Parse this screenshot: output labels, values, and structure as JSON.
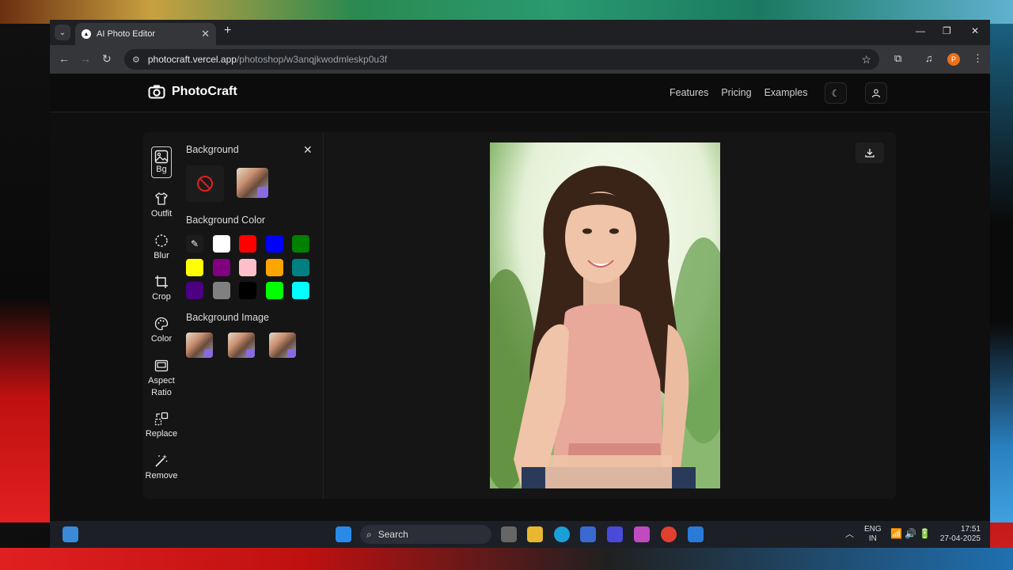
{
  "browser": {
    "tab_title": "AI Photo Editor",
    "url_host": "photocraft.vercel.app",
    "url_path": "/photoshop/w3anqjkwodmleskp0u3f",
    "profile_initial": "P"
  },
  "app": {
    "brand": "PhotoCraft",
    "nav": [
      "Features",
      "Pricing",
      "Examples"
    ]
  },
  "tools": [
    {
      "label": "Bg",
      "icon": "image-icon",
      "active": true
    },
    {
      "label": "Outfit",
      "icon": "shirt-icon"
    },
    {
      "label": "Blur",
      "icon": "blur-circle-icon"
    },
    {
      "label": "Crop",
      "icon": "crop-icon"
    },
    {
      "label": "Color",
      "icon": "palette-icon"
    },
    {
      "label": "Aspect Ratio",
      "icon": "aspect-ratio-icon"
    },
    {
      "label": "Replace",
      "icon": "replace-icon"
    },
    {
      "label": "Remove",
      "icon": "magic-wand-icon"
    }
  ],
  "side_panel": {
    "background_heading": "Background",
    "background_color_heading": "Background Color",
    "background_image_heading": "Background Image",
    "colors": [
      "#ffffff",
      "#ff0000",
      "#0000ff",
      "#008000",
      "#ffff00",
      "#800080",
      "#ffc0cb",
      "#ffa500",
      "#008080",
      "#4b0082",
      "#808080",
      "#000000",
      "#00ff00",
      "#00ffff"
    ]
  },
  "taskbar": {
    "search_label": "Search",
    "lang_top": "ENG",
    "lang_bottom": "IN",
    "time": "17:51",
    "date": "27-04-2025"
  }
}
